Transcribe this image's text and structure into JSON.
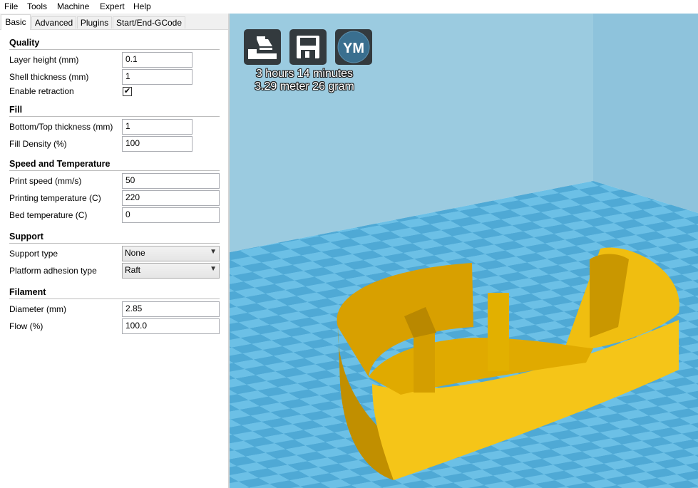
{
  "menu": [
    "File",
    "Tools",
    "Machine",
    "Expert",
    "Help"
  ],
  "tabs": [
    "Basic",
    "Advanced",
    "Plugins",
    "Start/End-GCode"
  ],
  "quality": {
    "title": "Quality",
    "layer_height_label": "Layer height (mm)",
    "layer_height": "0.1",
    "shell_thickness_label": "Shell thickness (mm)",
    "shell_thickness": "1",
    "retraction_label": "Enable retraction",
    "retraction_check": "✔"
  },
  "fill": {
    "title": "Fill",
    "bottom_top_label": "Bottom/Top thickness (mm)",
    "bottom_top": "1",
    "density_label": "Fill Density (%)",
    "density": "100"
  },
  "speed": {
    "title": "Speed and Temperature",
    "print_speed_label": "Print speed (mm/s)",
    "print_speed": "50",
    "print_temp_label": "Printing temperature (C)",
    "print_temp": "220",
    "bed_temp_label": "Bed temperature (C)",
    "bed_temp": "0"
  },
  "support": {
    "title": "Support",
    "type_label": "Support type",
    "type": "None",
    "adhesion_label": "Platform adhesion type",
    "adhesion": "Raft"
  },
  "filament": {
    "title": "Filament",
    "diameter_label": "Diameter (mm)",
    "diameter": "2.85",
    "flow_label": "Flow (%)",
    "flow": "100.0"
  },
  "viewport": {
    "icons": [
      "load-model-icon",
      "save-gcode-icon",
      "ym-icon"
    ],
    "ym_text": "YM",
    "print_time": "3 hours 14 minutes",
    "material": "3.29 meter 26 gram"
  }
}
